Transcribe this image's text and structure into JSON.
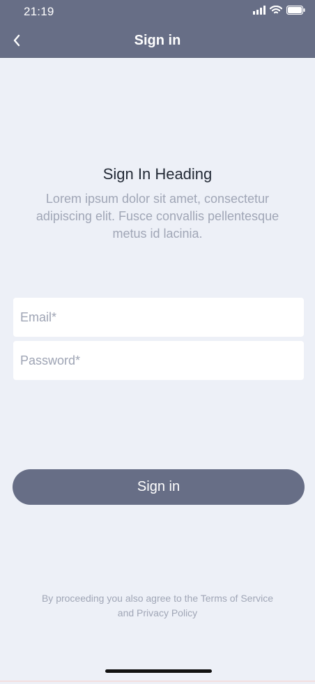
{
  "status": {
    "time": "21:19"
  },
  "header": {
    "title": "Sign in",
    "back_icon": "chevron-left-icon"
  },
  "content": {
    "heading": "Sign In Heading",
    "subtext": "Lorem ipsum dolor sit amet, consectetur adipiscing elit. Fusce convallis pellentesque metus id lacinia."
  },
  "form": {
    "email_placeholder": "Email*",
    "email_value": "",
    "password_placeholder": "Password*",
    "password_value": ""
  },
  "actions": {
    "signin_label": "Sign in"
  },
  "legal": {
    "line1": "By proceeding you also agree to the Terms of Service",
    "line2": "and Privacy Policy"
  },
  "colors": {
    "header": "#676e86",
    "background": "#edf0f7",
    "button": "#676e86",
    "muted_text": "#a0a6b6"
  }
}
